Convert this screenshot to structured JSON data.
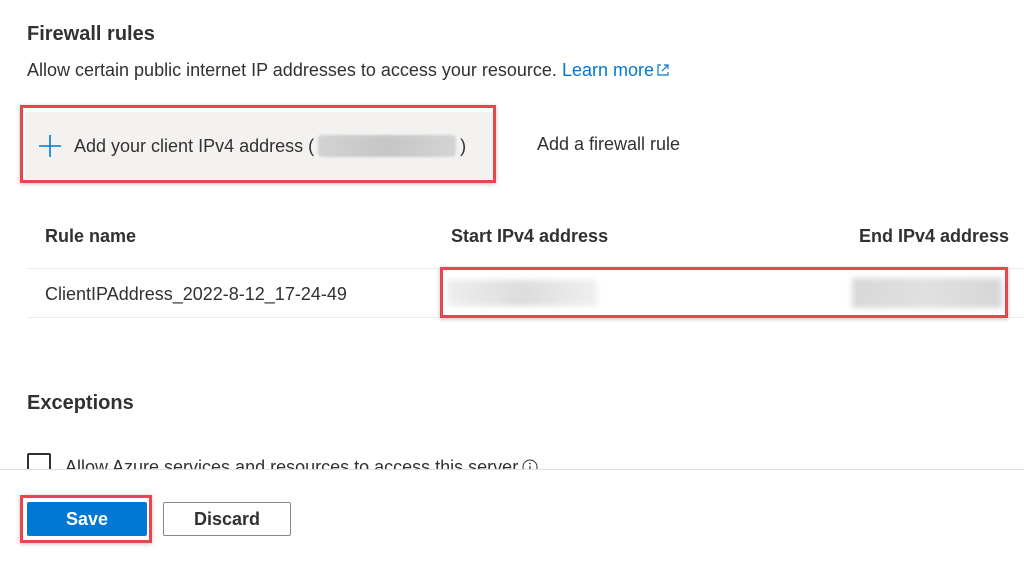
{
  "firewall": {
    "title": "Firewall rules",
    "description": "Allow certain public internet IP addresses to access your resource.",
    "learn_more": "Learn more",
    "add_client_prefix": "Add your client IPv4 address (",
    "add_client_suffix": ")",
    "add_rule": "Add a firewall rule"
  },
  "table": {
    "headers": [
      "Rule name",
      "Start IPv4 address",
      "End IPv4 address"
    ],
    "rows": [
      {
        "name": "ClientIPAddress_2022-8-12_17-24-49"
      }
    ]
  },
  "exceptions": {
    "title": "Exceptions",
    "allow_azure": "Allow Azure services and resources to access this server"
  },
  "footer": {
    "save": "Save",
    "discard": "Discard"
  },
  "colors": {
    "accent": "#0078d4",
    "highlight": "#e8464f"
  },
  "icons": [
    "plus-icon",
    "external-link-icon",
    "info-icon"
  ]
}
